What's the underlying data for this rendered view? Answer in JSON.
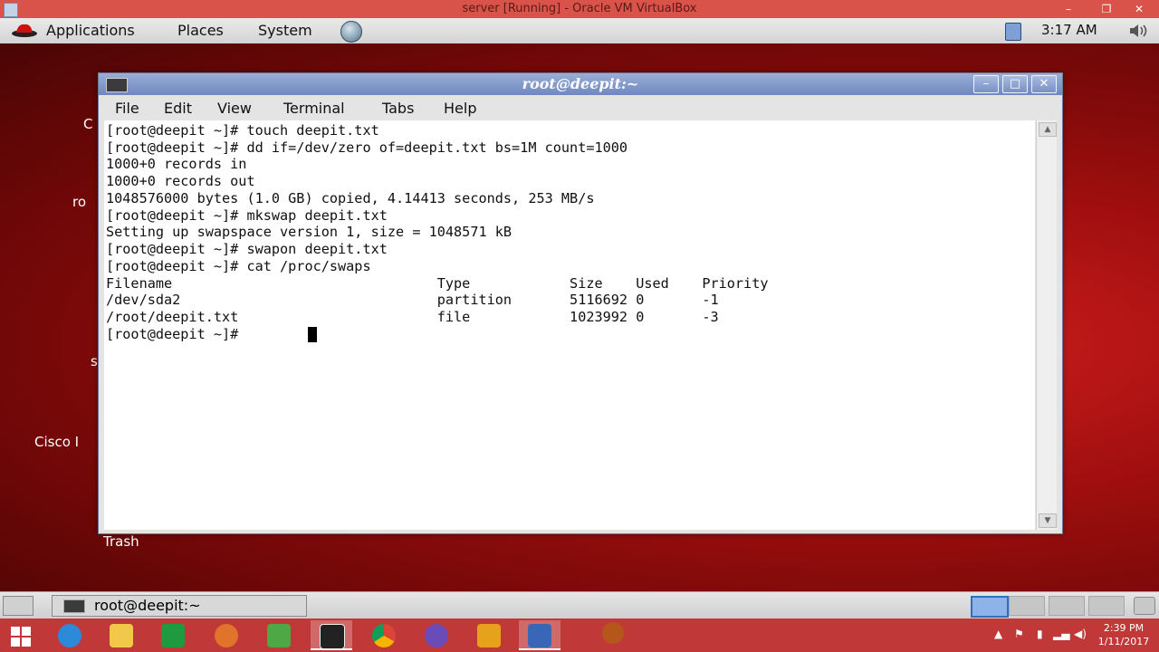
{
  "host": {
    "title": "server [Running] - Oracle VM VirtualBox",
    "clock_time": "2:39 PM",
    "clock_date": "1/11/2017"
  },
  "guest_panel": {
    "menus": [
      "Applications",
      "Places",
      "System"
    ],
    "time": "3:17 AM"
  },
  "desktop": {
    "labels": [
      "C",
      "ro",
      "s",
      "Cisco I"
    ],
    "trash": "Trash"
  },
  "terminal": {
    "title": "root@deepit:~",
    "menus": [
      "File",
      "Edit",
      "View",
      "Terminal",
      "Tabs",
      "Help"
    ],
    "lines": [
      "[root@deepit ~]# touch deepit.txt",
      "[root@deepit ~]# dd if=/dev/zero of=deepit.txt bs=1M count=1000",
      "1000+0 records in",
      "1000+0 records out",
      "1048576000 bytes (1.0 GB) copied, 4.14413 seconds, 253 MB/s",
      "[root@deepit ~]# mkswap deepit.txt",
      "Setting up swapspace version 1, size = 1048571 kB",
      "[root@deepit ~]# swapon deepit.txt",
      "[root@deepit ~]# cat /proc/swaps",
      "Filename                                Type            Size    Used    Priority",
      "/dev/sda2                               partition       5116692 0       -1",
      "/root/deepit.txt                        file            1023992 0       -3",
      "[root@deepit ~]# "
    ]
  },
  "guest_taskbar": {
    "task_label": "root@deepit:~"
  },
  "colors": {
    "host_title": "#d9534a",
    "win_taskbar": "#c03838",
    "desktop_red": "#a30f0f",
    "term_title": "#7891c4"
  }
}
